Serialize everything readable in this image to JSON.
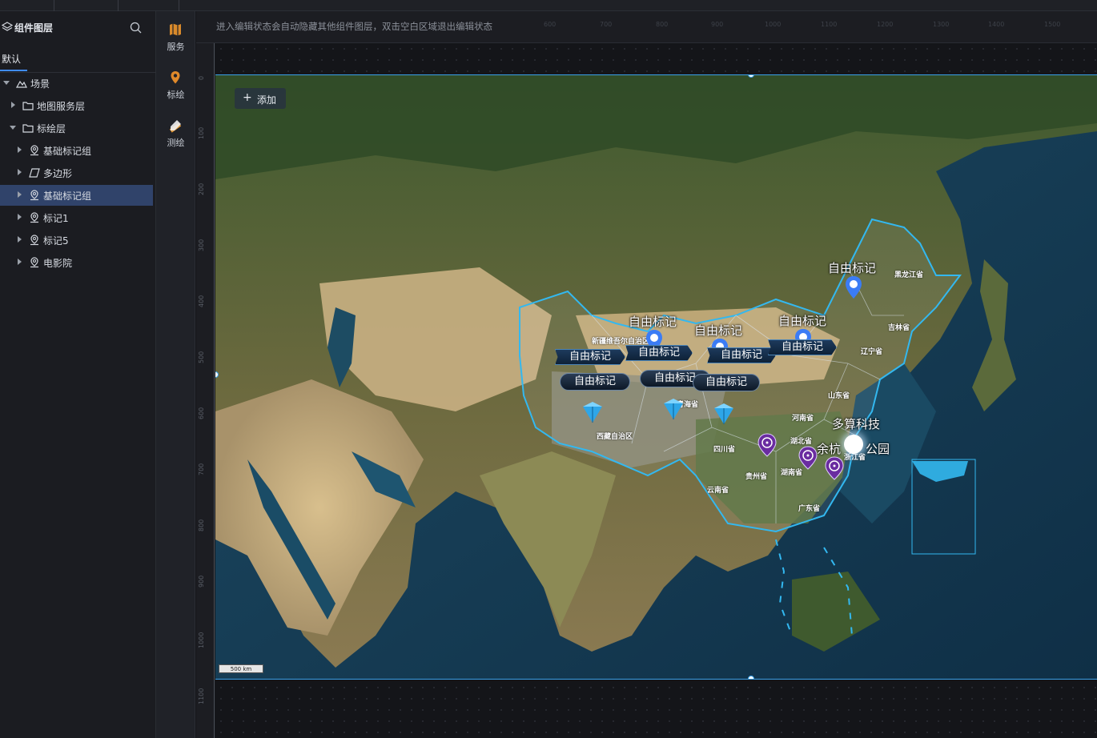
{
  "top_tabs": [
    {
      "label": ""
    },
    {
      "label": ""
    },
    {
      "label": ""
    }
  ],
  "layer_panel": {
    "title": "组件图层",
    "search_icon": "search-icon",
    "tab": "默认",
    "tree": [
      {
        "label": "场景",
        "icon": "mountain-icon",
        "expanded": true
      },
      {
        "label": "地图服务层",
        "icon": "folder-icon",
        "expanded": false
      },
      {
        "label": "标绘层",
        "icon": "folder-icon",
        "expanded": true
      },
      {
        "label": "基础标记组",
        "icon": "map-pin-icon",
        "expanded": false
      },
      {
        "label": "多边形",
        "icon": "polygon-icon",
        "expanded": false
      },
      {
        "label": "基础标记组",
        "icon": "map-pin-icon",
        "expanded": false,
        "selected": true
      },
      {
        "label": "标记1",
        "icon": "map-pin-icon",
        "expanded": false
      },
      {
        "label": "标记5",
        "icon": "map-pin-icon",
        "expanded": false
      },
      {
        "label": "电影院",
        "icon": "map-pin-icon",
        "expanded": false
      }
    ]
  },
  "tool_rail": {
    "items": [
      {
        "label": "服务",
        "icon": "map-book-icon"
      },
      {
        "label": "标绘",
        "icon": "location-pin-icon"
      },
      {
        "label": "测绘",
        "icon": "ruler-pencil-icon"
      }
    ]
  },
  "editor": {
    "hint": "进入编辑状态会自动隐藏其他组件图层，双击空白区域退出编辑状态",
    "ruler_h_ticks": [
      "600",
      "700",
      "800",
      "900",
      "1000",
      "1100",
      "1200",
      "1300",
      "1400",
      "1500"
    ],
    "ruler_v_ticks": [
      "0",
      "100",
      "200",
      "300",
      "400",
      "500",
      "600",
      "700",
      "800",
      "900",
      "1000",
      "1100"
    ]
  },
  "map": {
    "add_button": "添加",
    "scale_text": "500 km",
    "free_mark_label": "自由标记",
    "markers": {
      "pin_labels": [
        "自由标记",
        "自由标记",
        "自由标记",
        "自由标记"
      ],
      "box_labels": [
        "自由标记",
        "自由标记",
        "自由标记",
        "自由标记"
      ],
      "pill_labels": [
        "自由标记",
        "自由标记",
        "自由标记"
      ],
      "poi_labels": [
        "多算科技",
        "余杭",
        "公园"
      ]
    },
    "provinces": [
      "黑龙江省",
      "吉林省",
      "辽宁省",
      "新疆维吾尔自治区",
      "山东省",
      "河南省",
      "湖北省",
      "四川省",
      "湖南省",
      "贵州省",
      "云南省",
      "广东省",
      "西藏自治区",
      "浙江省",
      "青海省"
    ],
    "colors": {
      "boundary": "#33b8f0",
      "pin": "#3b7cf5",
      "cinema_pin": "#6a2ca0",
      "accent": "#3f8cff"
    }
  }
}
